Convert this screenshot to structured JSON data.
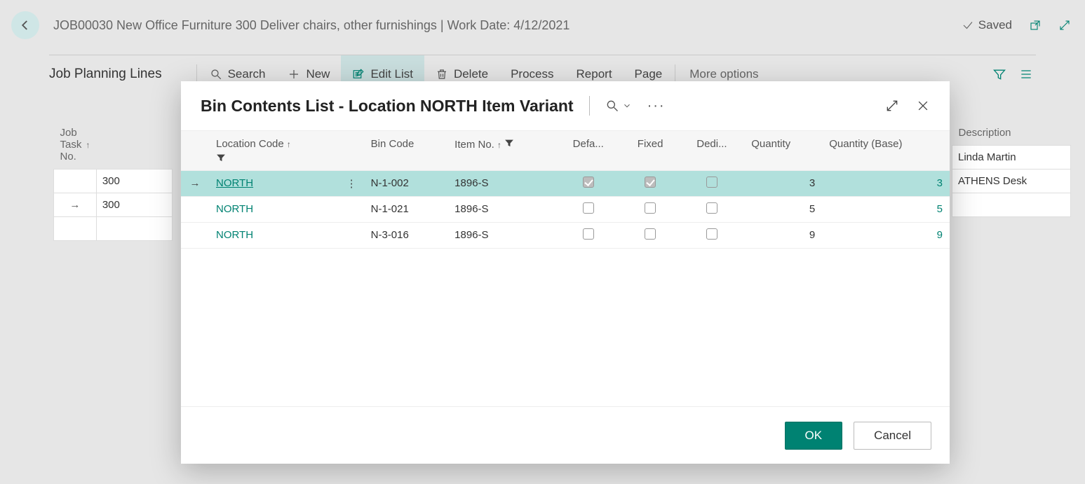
{
  "header": {
    "title": "JOB00030 New Office Furniture 300 Deliver chairs, other furnishings | Work Date: 4/12/2021",
    "saved_label": "Saved"
  },
  "section": {
    "title": "Job Planning Lines",
    "actions": {
      "search": "Search",
      "new": "New",
      "edit_list": "Edit List",
      "delete": "Delete",
      "process": "Process",
      "report": "Report",
      "page_menu": "Page",
      "more_options": "More options"
    }
  },
  "bg_grid": {
    "col_task": "Job Task No.",
    "col_desc": "Description",
    "rows": [
      {
        "marker": "",
        "task_no": "300",
        "desc": "Linda Martin"
      },
      {
        "marker": "→",
        "task_no": "300",
        "desc": "ATHENS Desk"
      }
    ]
  },
  "modal": {
    "title": "Bin Contents List - Location NORTH Item Variant",
    "columns": {
      "location": "Location Code",
      "bin": "Bin Code",
      "item": "Item No.",
      "default": "Defa...",
      "fixed": "Fixed",
      "dedicated": "Dedi...",
      "qty": "Quantity",
      "qty_base": "Quantity (Base)"
    },
    "rows": [
      {
        "selected": true,
        "location": "NORTH",
        "bin": "N-1-002",
        "item": "1896-S",
        "default": true,
        "fixed": true,
        "dedicated": false,
        "qty": "3",
        "qty_base": "3"
      },
      {
        "selected": false,
        "location": "NORTH",
        "bin": "N-1-021",
        "item": "1896-S",
        "default": false,
        "fixed": false,
        "dedicated": false,
        "qty": "5",
        "qty_base": "5"
      },
      {
        "selected": false,
        "location": "NORTH",
        "bin": "N-3-016",
        "item": "1896-S",
        "default": false,
        "fixed": false,
        "dedicated": false,
        "qty": "9",
        "qty_base": "9"
      }
    ],
    "footer": {
      "ok": "OK",
      "cancel": "Cancel"
    }
  }
}
